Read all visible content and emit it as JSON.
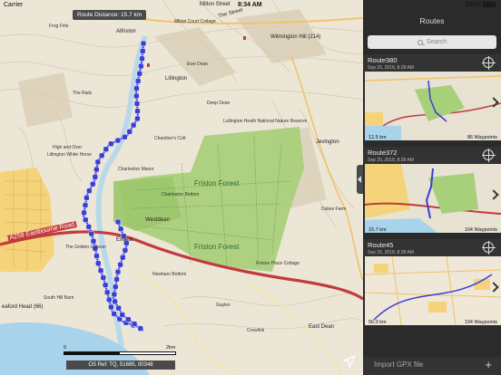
{
  "status": {
    "carrier": "Carrier",
    "time": "8:34 AM",
    "battery": "100%"
  },
  "map": {
    "route_distance": "Route Distance: 15.7 km",
    "os_ref": "OS Ref: TQ, 51695, 00348",
    "scale_start": "0",
    "scale_end": "2km",
    "labels": {
      "alfriston": "Alfriston",
      "milton_street": "Milton Street",
      "milton_court": "Milton Court Cottage",
      "wilmington_hill": "Wilmington Hill (214)",
      "litlington": "Litlington",
      "deep_dean": "Deep Dean",
      "lullington": "Lullington Heath National Nature Reserve",
      "jevington": "Jevington",
      "chambers_cott": "Chamber's Cott",
      "friston_forest": "Friston Forest",
      "friston_forest_2": "Friston Forest",
      "charleston_manor": "Charleston Manor",
      "charleston_bottom": "Charleston Bottom",
      "westdean": "Westdean",
      "exceat": "Exceat",
      "eastbourne_road": "A259 Eastbourne Road",
      "high_and_over": "High and Over",
      "the_rails": "The Rails",
      "litlington_white_horse": "Litlington White Horse",
      "the_golden_galleon": "The Golden Galleon",
      "newbarn_bottom": "Newbarn Bottom",
      "south_hill_barn": "South Hill Barn",
      "seaford_head": "eaford Head (66)",
      "east_dean": "East Dean",
      "gayles": "Gayles",
      "dukes_farm": "Dukes Farm",
      "friston_place": "Friston Place Cottage",
      "crowlink": "Crowlink",
      "frog_firle": "Frog Firle",
      "ewe_dean": "Ewe Dean",
      "the_street": "The Street"
    }
  },
  "sidebar": {
    "title": "Routes",
    "search_placeholder": "Search",
    "routes": [
      {
        "name": "Route380",
        "date": "Sep 25, 2018, 8:28 AM",
        "distance": "12.5 km",
        "waypoints": "86 Waypoints"
      },
      {
        "name": "Route372",
        "date": "Sep 25, 2018, 8:28 AM",
        "distance": "15.7 km",
        "waypoints": "104 Waypoints"
      },
      {
        "name": "Route45",
        "date": "Sep 25, 2018, 8:28 AM",
        "distance": "56.0 km",
        "waypoints": "104 Waypoints"
      }
    ],
    "import_label": "Import GPX file",
    "import_plus": "+"
  },
  "colors": {
    "route_blue": "#3a3fd6",
    "forest_green": "#a8cf7a",
    "sea": "#a9d3ea",
    "sidebar_bg": "#2b2b2b",
    "road_red": "#c23b3b"
  }
}
